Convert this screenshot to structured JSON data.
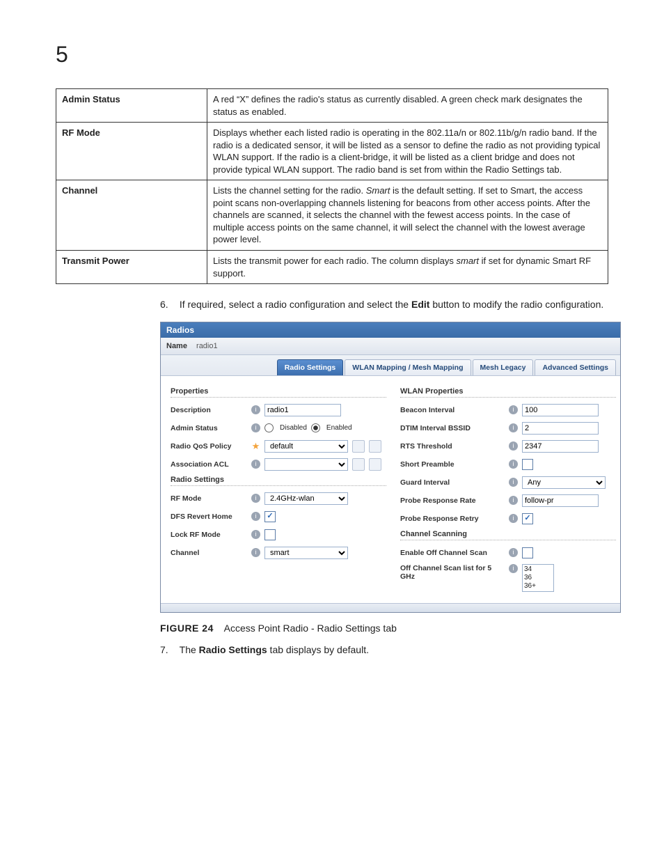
{
  "page_number": "5",
  "table": {
    "rows": [
      {
        "key": "Admin Status",
        "val": "A red “X” defines the radio's status as currently disabled. A green check mark designates the status as enabled."
      },
      {
        "key": "RF Mode",
        "val": "Displays whether each listed radio is operating in the 802.11a/n or 802.11b/g/n radio band. If the radio is a dedicated sensor, it will be listed as a sensor to define the radio as not providing typical WLAN support. If the radio is a client-bridge, it will be listed as a client bridge and does not provide typical WLAN support. The radio band is set from within the Radio Settings tab."
      },
      {
        "key": "Channel",
        "val_pre": "Lists the channel setting for the radio. ",
        "val_em": "Smart",
        "val_post": " is the default setting. If set to Smart, the access point scans non-overlapping channels listening for beacons from other access points. After the channels are scanned, it selects the channel with the fewest access points. In the case of multiple access points on the same channel, it will select the channel with the lowest average power level."
      },
      {
        "key": "Transmit Power",
        "val_pre": "Lists the transmit power for each radio. The column displays ",
        "val_em": "smart",
        "val_post": " if set for dynamic Smart RF support."
      }
    ]
  },
  "step6": {
    "num": "6.",
    "pre": "If required, select a radio configuration and select the ",
    "bold": "Edit",
    "post": " button to modify the radio configuration."
  },
  "step7": {
    "num": "7.",
    "pre": "The ",
    "bold": "Radio Settings",
    "post": " tab displays by default."
  },
  "figure": {
    "label": "FIGURE 24",
    "caption": "Access Point Radio - Radio Settings tab"
  },
  "shot": {
    "title": "Radios",
    "name_label": "Name",
    "name_value": "radio1",
    "tabs": [
      "Radio Settings",
      "WLAN Mapping / Mesh Mapping",
      "Mesh Legacy",
      "Advanced Settings"
    ],
    "active_tab": 0,
    "left": {
      "properties_title": "Properties",
      "description": {
        "label": "Description",
        "value": "radio1"
      },
      "admin_status": {
        "label": "Admin Status",
        "opt_disabled": "Disabled",
        "opt_enabled": "Enabled"
      },
      "qos": {
        "label": "Radio QoS Policy",
        "value": "default"
      },
      "acl": {
        "label": "Association ACL"
      },
      "radio_settings_title": "Radio Settings",
      "rf_mode": {
        "label": "RF Mode",
        "value": "2.4GHz-wlan"
      },
      "dfs": {
        "label": "DFS Revert Home"
      },
      "lock": {
        "label": "Lock RF Mode"
      },
      "channel": {
        "label": "Channel",
        "value": "smart"
      }
    },
    "right": {
      "wlan_title": "WLAN Properties",
      "beacon": {
        "label": "Beacon Interval",
        "value": "100"
      },
      "dtim": {
        "label": "DTIM Interval BSSID",
        "value": "2"
      },
      "rts": {
        "label": "RTS Threshold",
        "value": "2347"
      },
      "short_preamble": {
        "label": "Short Preamble"
      },
      "guard": {
        "label": "Guard Interval",
        "value": "Any"
      },
      "probe_rate": {
        "label": "Probe Response Rate",
        "value": "follow-pr"
      },
      "probe_retry": {
        "label": "Probe Response Retry"
      },
      "scan_title": "Channel Scanning",
      "enable_scan": {
        "label": "Enable Off Channel Scan"
      },
      "scan_list": {
        "label": "Off Channel Scan list for 5 GHz",
        "values": [
          "34",
          "36",
          "36+"
        ]
      }
    }
  }
}
